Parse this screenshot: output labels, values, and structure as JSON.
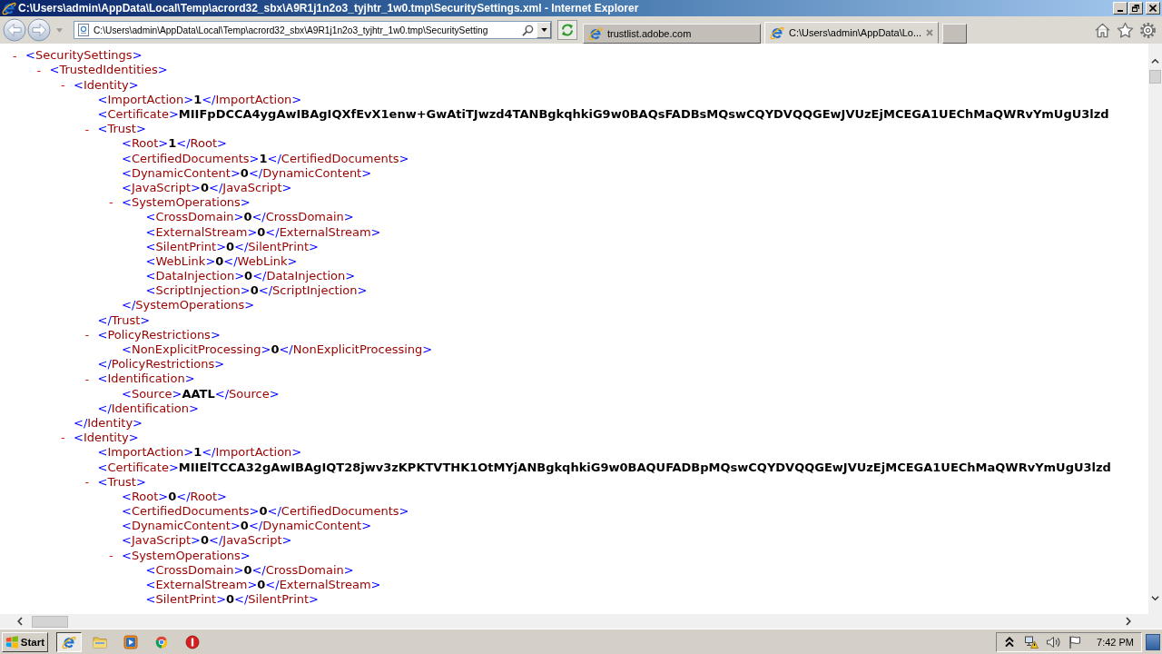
{
  "window": {
    "title": "C:\\Users\\admin\\AppData\\Local\\Temp\\acrord32_sbx\\A9R1j1n2o3_tyjhtr_1w0.tmp\\SecuritySettings.xml - Internet Explorer"
  },
  "toolbar": {
    "address": "C:\\Users\\admin\\AppData\\Local\\Temp\\acrord32_sbx\\A9R1j1n2o3_tyjhtr_1w0.tmp\\SecuritySetting",
    "tabs": [
      {
        "title": "trustlist.adobe.com",
        "selected": false
      },
      {
        "title": "C:\\Users\\admin\\AppData\\Lo...",
        "selected": true
      }
    ]
  },
  "document": {
    "nodes": [
      {
        "toggle": "-",
        "open": "<SecuritySettings>",
        "children": [
          {
            "toggle": "-",
            "open": "<TrustedIdentities>",
            "children": [
              {
                "toggle": "-",
                "open": "<Identity>",
                "children": [
                  {
                    "open": "<ImportAction>",
                    "value": "1",
                    "close": "</ImportAction>"
                  },
                  {
                    "open": "<Certificate>",
                    "value": "MIIFpDCCA4ygAwIBAgIQXfEvX1enw+GwAtiTJwzd4TANBgkqhkiG9w0BAQsFADBsMQswCQYDVQQGEwJVUzEjMCEGA1UEChMaQWRvYmUgU3lzd"
                  },
                  {
                    "toggle": "-",
                    "open": "<Trust>",
                    "children": [
                      {
                        "open": "<Root>",
                        "value": "1",
                        "close": "</Root>"
                      },
                      {
                        "open": "<CertifiedDocuments>",
                        "value": "1",
                        "close": "</CertifiedDocuments>"
                      },
                      {
                        "open": "<DynamicContent>",
                        "value": "0",
                        "close": "</DynamicContent>"
                      },
                      {
                        "open": "<JavaScript>",
                        "value": "0",
                        "close": "</JavaScript>"
                      },
                      {
                        "toggle": "-",
                        "open": "<SystemOperations>",
                        "children": [
                          {
                            "open": "<CrossDomain>",
                            "value": "0",
                            "close": "</CrossDomain>"
                          },
                          {
                            "open": "<ExternalStream>",
                            "value": "0",
                            "close": "</ExternalStream>"
                          },
                          {
                            "open": "<SilentPrint>",
                            "value": "0",
                            "close": "</SilentPrint>"
                          },
                          {
                            "open": "<WebLink>",
                            "value": "0",
                            "close": "</WebLink>"
                          },
                          {
                            "open": "<DataInjection>",
                            "value": "0",
                            "close": "</DataInjection>"
                          },
                          {
                            "open": "<ScriptInjection>",
                            "value": "0",
                            "close": "</ScriptInjection>"
                          }
                        ],
                        "close": "</SystemOperations>"
                      }
                    ],
                    "close": "</Trust>"
                  },
                  {
                    "toggle": "-",
                    "open": "<PolicyRestrictions>",
                    "children": [
                      {
                        "open": "<NonExplicitProcessing>",
                        "value": "0",
                        "close": "</NonExplicitProcessing>"
                      }
                    ],
                    "close": "</PolicyRestrictions>"
                  },
                  {
                    "toggle": "-",
                    "open": "<Identification>",
                    "children": [
                      {
                        "open": "<Source>",
                        "value": "AATL",
                        "close": "</Source>"
                      }
                    ],
                    "close": "</Identification>"
                  }
                ],
                "close": "</Identity>"
              },
              {
                "toggle": "-",
                "open": "<Identity>",
                "children": [
                  {
                    "open": "<ImportAction>",
                    "value": "1",
                    "close": "</ImportAction>"
                  },
                  {
                    "open": "<Certificate>",
                    "value": "MIIElTCCA32gAwIBAgIQT28jwv3zKPKTVTHK1OtMYjANBgkqhkiG9w0BAQUFADBpMQswCQYDVQQGEwJVUzEjMCEGA1UEChMaQWRvYmUgU3lzd"
                  },
                  {
                    "toggle": "-",
                    "open": "<Trust>",
                    "children": [
                      {
                        "open": "<Root>",
                        "value": "0",
                        "close": "</Root>"
                      },
                      {
                        "open": "<CertifiedDocuments>",
                        "value": "0",
                        "close": "</CertifiedDocuments>"
                      },
                      {
                        "open": "<DynamicContent>",
                        "value": "0",
                        "close": "</DynamicContent>"
                      },
                      {
                        "open": "<JavaScript>",
                        "value": "0",
                        "close": "</JavaScript>"
                      },
                      {
                        "toggle": "-",
                        "open": "<SystemOperations>",
                        "children": [
                          {
                            "open": "<CrossDomain>",
                            "value": "0",
                            "close": "</CrossDomain>"
                          },
                          {
                            "open": "<ExternalStream>",
                            "value": "0",
                            "close": "</ExternalStream>"
                          },
                          {
                            "open": "<SilentPrint>",
                            "value": "0",
                            "close": "</SilentPrint>"
                          }
                        ]
                      }
                    ]
                  }
                ]
              }
            ]
          }
        ]
      }
    ]
  },
  "taskbar": {
    "start": "Start",
    "apps": [
      {
        "selected": true
      },
      {
        "selected": false
      },
      {
        "selected": false
      },
      {
        "selected": false
      },
      {
        "selected": false
      }
    ],
    "clock": "7:42 PM"
  }
}
